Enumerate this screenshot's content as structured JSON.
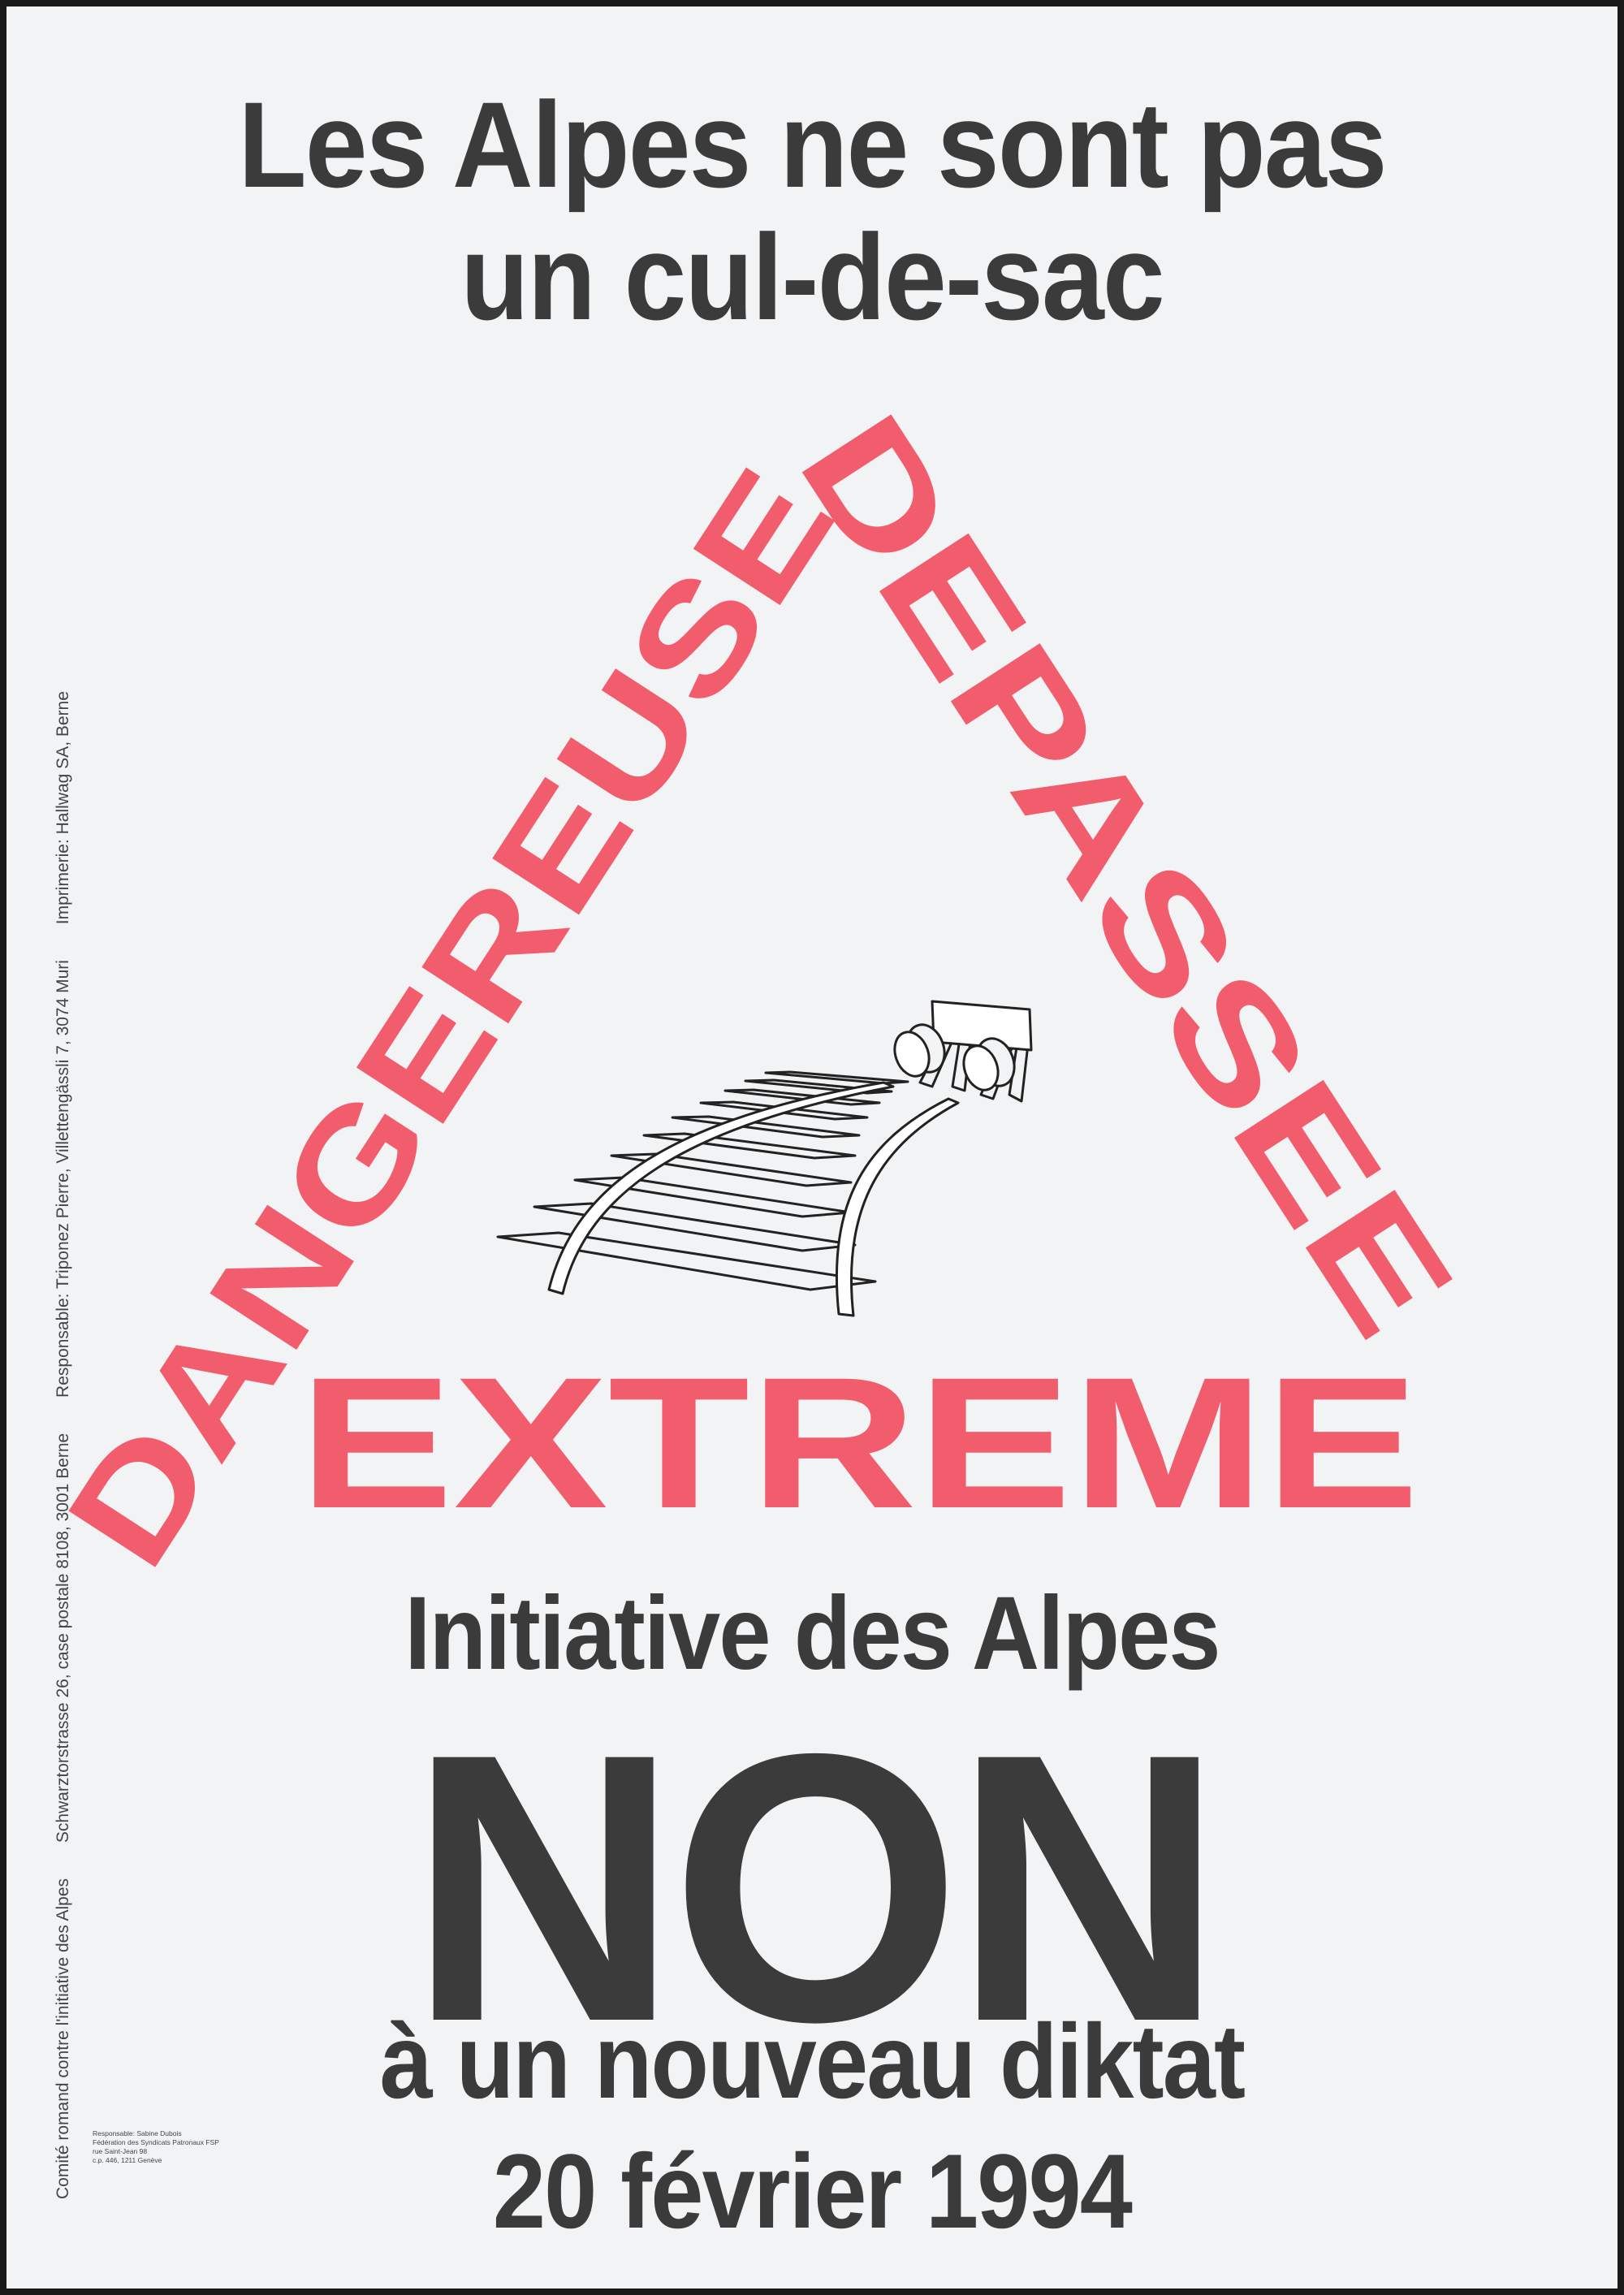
{
  "headline": {
    "line1": "Les Alpes ne sont pas",
    "line2": "un cul-de-sac"
  },
  "triangle": {
    "left_word": "DANGEREUSE",
    "right_word": "DEPASSEE",
    "bottom_word": "EXTREME",
    "color": "#f25d6e",
    "center_icon": "railway-buffer-stop-icon"
  },
  "campaign": {
    "title": "Initiative des Alpes",
    "vote": "NON",
    "subtitle": "à un nouveau diktat",
    "date": "20 février 1994"
  },
  "sidebar": {
    "committee": "Comité romand contre l'initiative des Alpes",
    "address": "Schwarztorstrasse 26, case postale 8108, 3001 Berne",
    "responsible": "Responsable: Triponez Pierre, Villettengässli 7, 3074 Muri",
    "printer": "Imprimerie: Hallwag SA, Berne"
  },
  "imprint": {
    "line1": "Responsable: Sabine Dubois",
    "line2": "Fédération des Syndicats Patronaux FSP",
    "line3": "rue Saint-Jean 98",
    "line4": "c.p. 446, 1211 Genève"
  },
  "colors": {
    "text": "#3b3b3b",
    "accent": "#f25d6e",
    "paper": "#f1f3f5"
  }
}
